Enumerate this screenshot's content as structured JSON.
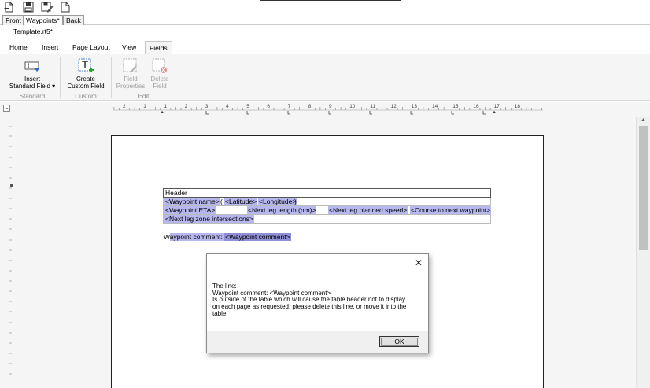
{
  "quick_access": {
    "icons": [
      "new-document-icon",
      "save-icon",
      "save-all-icon",
      "document-icon"
    ]
  },
  "document_tabs": [
    {
      "label": "Front",
      "active": false
    },
    {
      "label": "Waypoints*",
      "active": true
    },
    {
      "label": "Back",
      "active": false
    }
  ],
  "file_name": "Template.rt5*",
  "ribbon": {
    "tabs": [
      "Home",
      "Insert",
      "Page Layout",
      "View",
      "Fields"
    ],
    "active_tab": "Fields",
    "groups": [
      {
        "label": "Standard",
        "buttons": [
          {
            "line1": "Insert",
            "line2": "Standard Field ▾",
            "icon": "insert-field-icon",
            "enabled": true
          }
        ]
      },
      {
        "label": "Custom",
        "buttons": [
          {
            "line1": "Create",
            "line2": "Custom Field",
            "icon": "create-custom-field-icon",
            "enabled": true
          }
        ]
      },
      {
        "label": "Edit",
        "buttons": [
          {
            "line1": "Field",
            "line2": "Properties",
            "icon": "field-properties-icon",
            "enabled": false
          },
          {
            "line1": "Delete",
            "line2": "Field",
            "icon": "delete-field-icon",
            "enabled": false
          }
        ]
      }
    ]
  },
  "ruler": {
    "corner": "L",
    "numbers": [
      "2",
      "1",
      "1",
      "2",
      "3",
      "4",
      "5",
      "6",
      "7",
      "8",
      "9",
      "10",
      "11",
      "12",
      "13",
      "14",
      "15",
      "16",
      "17",
      "18"
    ]
  },
  "document": {
    "table": {
      "header": "Header",
      "rows": [
        [
          {
            "text": "<Waypoint name>",
            "field": true
          },
          {
            "text": " (",
            "field": false
          },
          {
            "text": "<Latitude>",
            "field": true
          },
          {
            "text": ",",
            "field": false
          },
          {
            "text": "<Longitude>",
            "field": true
          },
          {
            "text": ")",
            "field": false
          }
        ],
        [
          {
            "text": "<Waypoint ETA>",
            "field": true
          },
          {
            "text": "<Next leg length (nm)>",
            "field": true
          },
          {
            "text": "<Next leg planned speed>",
            "field": true
          },
          {
            "text": "<Course to next waypoint>",
            "field": true
          }
        ],
        [
          {
            "text": "<Next leg zone intersections>",
            "field": true
          }
        ]
      ]
    },
    "comment_line": {
      "first_char": "W",
      "label": "aypoint comment: ",
      "field": "<Waypoint comment>"
    }
  },
  "dialog": {
    "close_glyph": "✕",
    "message": "The line:\nWaypoint comment: <Waypoint comment>\nIs outside of the table which will cause the table header not to display\non each page as requested, please delete this line, or move it into the\ntable",
    "ok_label": "OK"
  },
  "colors": {
    "field_highlight": "#b7b7ef",
    "selection": "#9999df",
    "ribbon_bg": "#f5f5f5"
  }
}
